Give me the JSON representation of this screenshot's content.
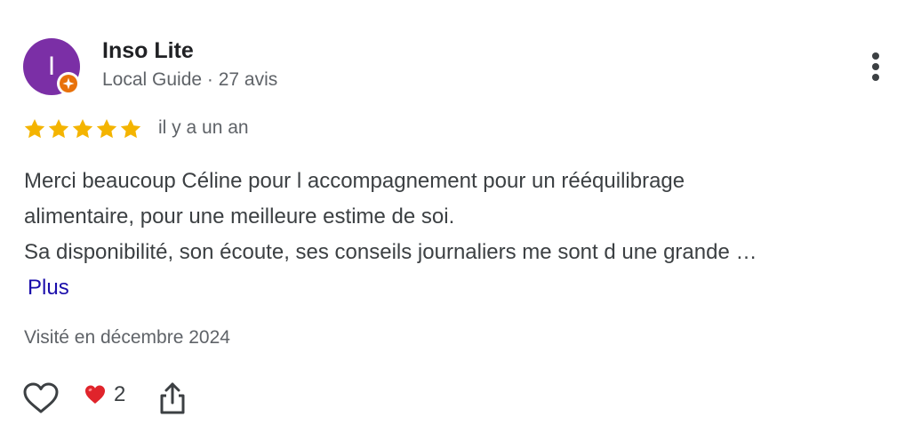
{
  "author": {
    "initial": "I",
    "name": "Inso Lite",
    "meta": "Local Guide · 27 avis",
    "avatar_color": "#7b2fa6",
    "badge_color": "#e8710a"
  },
  "rating": {
    "stars": 5,
    "max": 5,
    "star_color": "#f4b400",
    "time_ago": "il y a un an"
  },
  "review": {
    "lines": [
      "Merci beaucoup Céline pour l accompagnement pour un rééquilibrage",
      "alimentaire, pour une meilleure estime de soi.",
      "Sa disponibilité, son écoute, ses conseils journaliers me sont d une grande …"
    ],
    "more_label": "Plus",
    "link_color": "#1a0dab"
  },
  "visited": "Visité en décembre 2024",
  "actions": {
    "reaction_emoji": "❤️",
    "reaction_count": "2",
    "icons": [
      "heart-outline-icon",
      "share-icon",
      "more-vert-icon"
    ]
  }
}
